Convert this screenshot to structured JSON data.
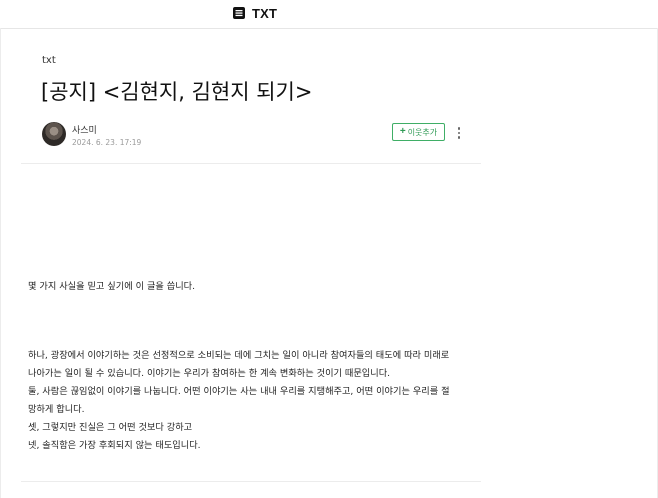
{
  "header": {
    "brand_icon": "document-list-icon",
    "brand_text": "TXT"
  },
  "post": {
    "category": "txt",
    "title": "[공지] <김현지, 김현지 되기>",
    "author": "사스미",
    "date": "2024. 6. 23. 17:19",
    "neighbor_button_plus": "+",
    "neighbor_button_label": "이웃추가",
    "more_icon": "more-vertical-icon"
  },
  "content": {
    "intro": "몇 가지 사실을 믿고 싶기에 이 글을 씁니다.",
    "lines": [
      "하나, 광장에서 이야기하는 것은 선정적으로 소비되는 데에 그치는 일이 아니라 참여자들의 태도에 따라 미래로",
      "나아가는 일이 될 수 있습니다. 이야기는 우리가 참여하는 한 계속 변화하는 것이기 때문입니다.",
      "둘, 사람은 끊임없이 이야기를 나눕니다. 어떤 이야기는 사는 내내 우리를 지탱해주고, 어떤 이야기는 우리를 절",
      "망하게 합니다.",
      "셋, 그렇지만 진실은 그 어떤 것보다 강하고",
      "넷, 솔직함은 가장 후회되지 않는 태도입니다."
    ]
  }
}
